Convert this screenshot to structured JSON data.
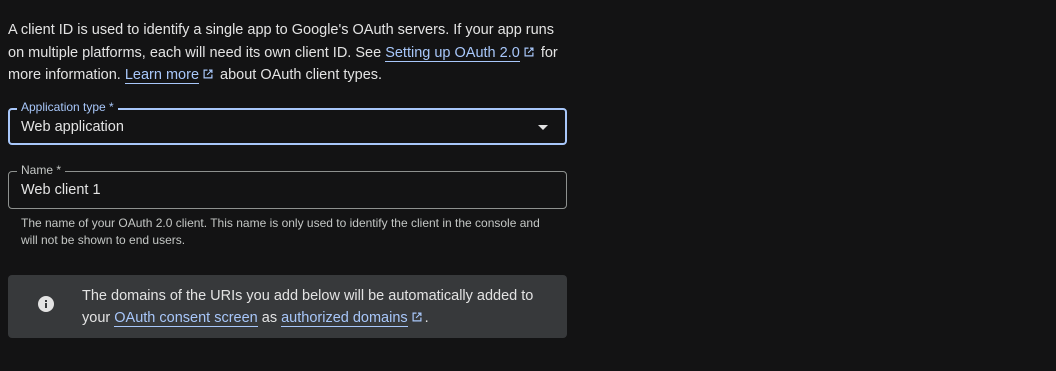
{
  "intro": {
    "text_1": "A client ID is used to identify a single app to Google's OAuth servers. If your app runs on multiple platforms, each will need its own client ID. See ",
    "link_setup": "Setting up OAuth 2.0",
    "text_2": " for more information. ",
    "link_learn": "Learn more",
    "text_3": " about OAuth client types."
  },
  "app_type": {
    "label": "Application type *",
    "value": "Web application"
  },
  "name_field": {
    "label": "Name *",
    "value": "Web client 1",
    "hint": "The name of your OAuth 2.0 client. This name is only used to identify the client in the console and will not be shown to end users."
  },
  "info": {
    "text_1": "The domains of the URIs you add below will be automatically added to your ",
    "link_consent": "OAuth consent screen",
    "text_2": " as ",
    "link_domains": "authorized domains",
    "text_3": "."
  },
  "colors": {
    "background": "#131314",
    "accent": "#a8c7fa",
    "text": "#e3e3e3",
    "info_bg": "#37393b"
  },
  "icons": {
    "external": "open-in-new-icon",
    "info": "info-icon",
    "dropdown": "arrow-drop-down-icon"
  }
}
